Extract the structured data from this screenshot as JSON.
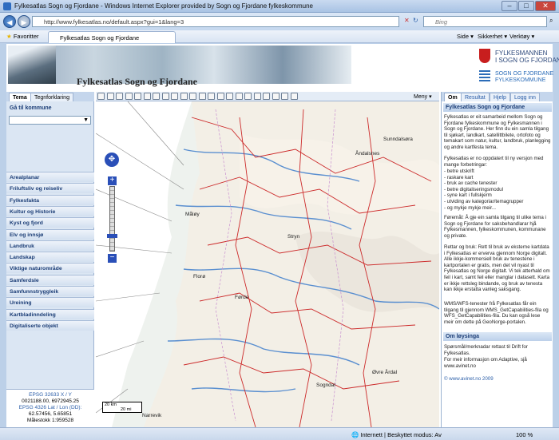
{
  "window": {
    "title": "Fylkesatlas Sogn og Fjordane - Windows Internet Explorer provided by Sogn og Fjordane fylkeskommune"
  },
  "address": {
    "url": "http://www.fylkesatlas.no/default.aspx?gui=1&lang=3",
    "search_placeholder": "Bing"
  },
  "favbar": {
    "favorites": "Favoritter",
    "tab": "Fylkesatlas Sogn og Fjordane",
    "menu": [
      "Side ▾",
      "Sikkerhet ▾",
      "Verktøy ▾"
    ]
  },
  "banner": {
    "title": "Fylkesatlas Sogn og Fjordane",
    "logo1": "FYLKESMANNEN",
    "logo1b": "I SOGN OG FJORDANE",
    "logo2": "SOGN OG FJORDANE",
    "logo2b": "FYLKESKOMMUNE"
  },
  "left": {
    "tabs": [
      "Tema",
      "Tegnforklaring"
    ],
    "goto_label": "Gå til kommune",
    "menu": [
      "Arealplanar",
      "Friluftsliv og reiseliv",
      "Fylkesfakta",
      "Kultur og Historie",
      "Kyst og fjord",
      "Elv og innsjø",
      "Landbruk",
      "Landskap",
      "Viktige naturområde",
      "Samferdsle",
      "Samfunnstryggleik",
      "Ureining",
      "Kartbladinndeling",
      "Digitaliserte objekt"
    ],
    "coords": {
      "epsg1": "EPSG 32633 X / Y",
      "val1": "0021188.00, 6972945.25",
      "epsg2": "EPSG 4326 Lat / Lon (DD):",
      "val2": "62.57456, 5.65851",
      "scale": "Målestokk 1:959528"
    }
  },
  "toolbar": {
    "meny": "Meny"
  },
  "map": {
    "scale_km": "20 km",
    "scale_mi": "20 mi",
    "places": [
      "Sunndalsøra",
      "Åndalsnes",
      "Måløy",
      "Stryn",
      "Florø",
      "Førde",
      "Sogndal",
      "Øvre Årdal",
      "Narrevik"
    ]
  },
  "right": {
    "tabs": [
      "Om",
      "Resultat",
      "Hjelp",
      "Logg inn"
    ],
    "heading": "Fylkesatlas Sogn og Fjordane",
    "p1": "Fylkesatlas er eit samarbeid mellom Sogn og Fjordane fylkeskommune og Fylkesmannen i Sogn og Fjordane. Her finn du ein samla tilgang til sjøkart, landkart, satellittbilete, ortofoto og temakart som natur, kultur, landbruk, planlegging og andre kartfesta tema.",
    "p2": "Fylkesatlas er no oppdatert til ny versjon med mange forbetringar:",
    "list": [
      "- betre utskrift",
      "- raskare kart",
      "- bruk av cache tenester",
      "- betre digitaliseringsmodul",
      "- syne kart i fullskjerm",
      "- utviding av kategoriar/temagrupper",
      "- og mykje mykje meir..."
    ],
    "p3": "Føremål: Å gje ein samla tilgang til ulike tema i Sogn og Fjordane for saksbehandlarar hjå Fylkesmannen, fylkeskommunen, kommunane og private.",
    "p4": "Rettar og bruk: Rett til bruk av eksterne kartdata i Fylkesatlas er erverva gjennom Norge digitalt. Alle ikkje-kommersiell bruk av tenestene i kartportalen er gratis, men det vil nyast til Fylkesatlas og Norge digitalt. Vi tek atterhald om feil i kart, samt feil eller manglar i datasett. Karta er ikkje rettsleg bindande, og bruk av tenesta kan ikkje erstatta vanleg saksgang.",
    "p5": "WMS/WFS-tenester frå Fylkesatlas får ein tilgang til gjennom WMS_GetCapabilities-fila og WFS_GetCapabilities-fila. Du kan også lese meir om dette på GeoNorge-portalen.",
    "heading2": "Om løysinga",
    "p6": "Spørsmål/merknadar rettast til Drift for Fylkesatlas.",
    "p7": "For meir informasjon om Adaptive, sjå www.avinet.no",
    "copy": "© www.avinet.no 2009"
  },
  "status": {
    "zone": "Internett | Beskyttet modus: Av",
    "zoom": "100 %"
  }
}
